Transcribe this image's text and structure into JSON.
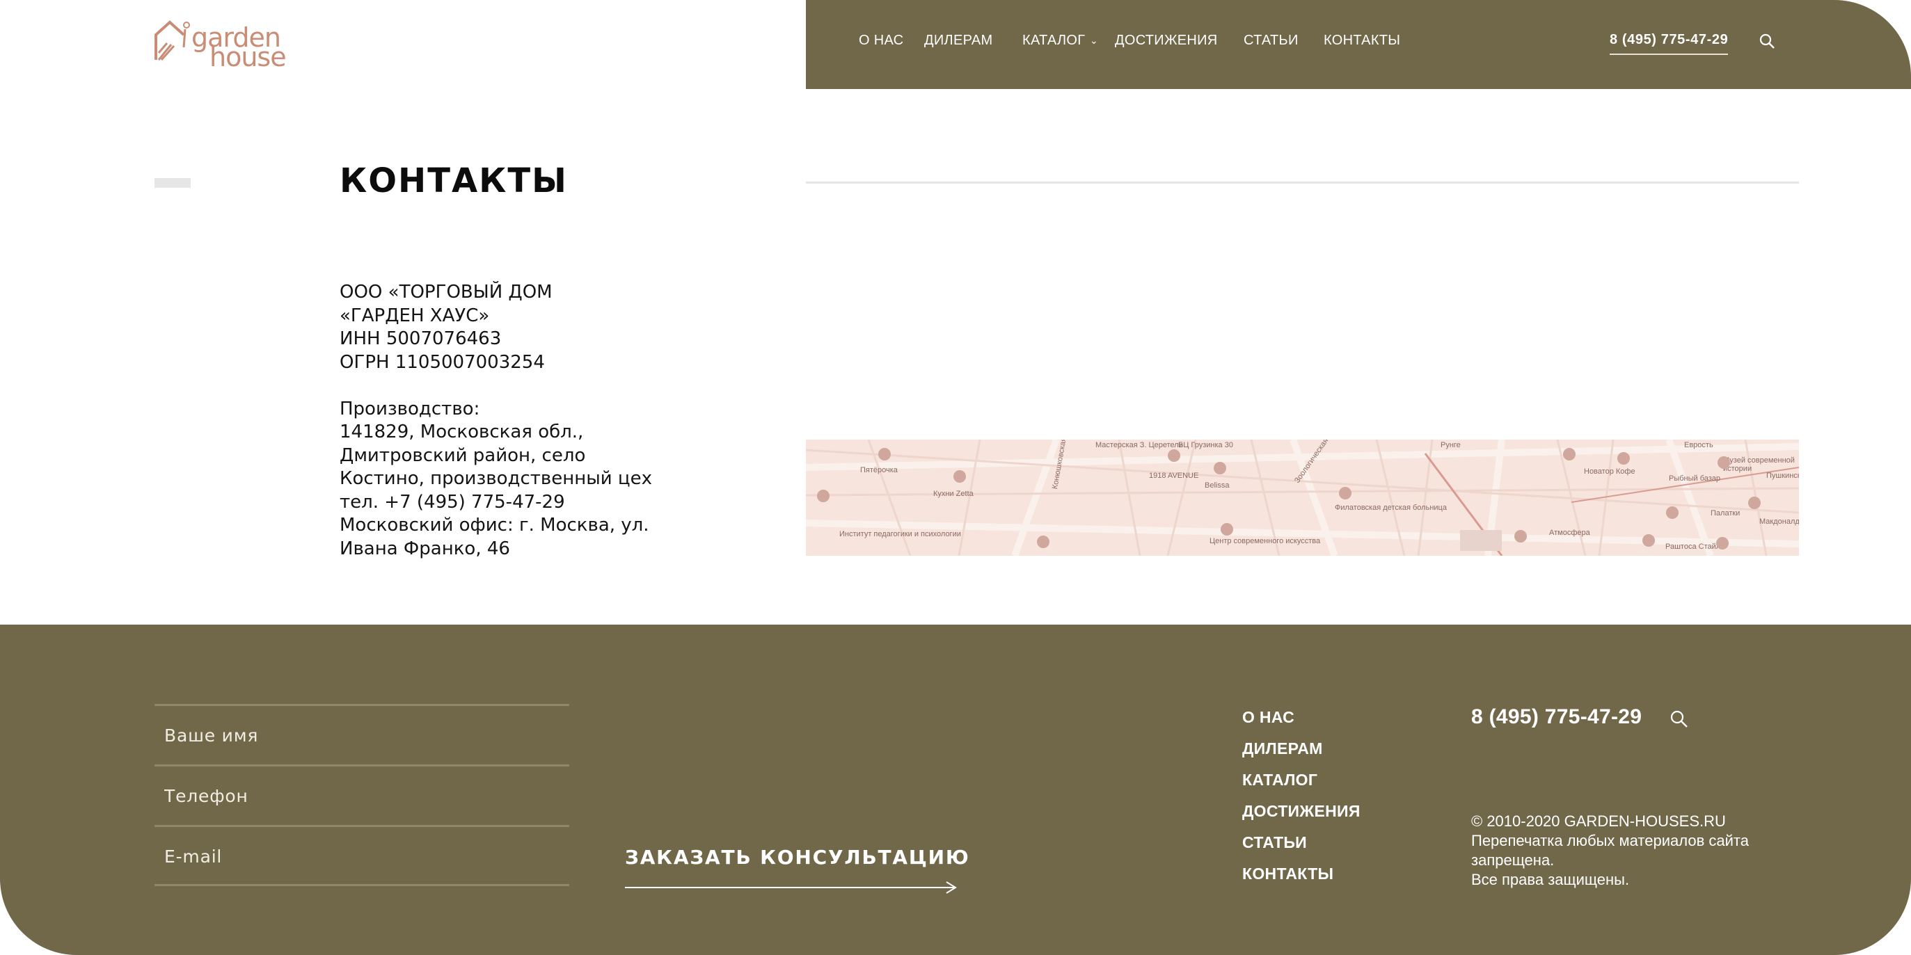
{
  "logo": {
    "line1": "garden",
    "line2": "house"
  },
  "nav": {
    "items": [
      {
        "label": "О НАС"
      },
      {
        "label": "ДИЛЕРАМ"
      },
      {
        "label": "КАТАЛОГ"
      },
      {
        "label": "ДОСТИЖЕНИЯ"
      },
      {
        "label": "СТАТЬИ"
      },
      {
        "label": "КОНТАКТЫ"
      }
    ],
    "chevron": "⌄",
    "phone": "8 (495) 775-47-29",
    "search_icon": "search-icon"
  },
  "page": {
    "title": "КОНТАКТЫ"
  },
  "company": {
    "lines": [
      "ООО «ТОРГОВЫЙ ДОМ",
      "«ГАРДЕН ХАУС»",
      "ИНН 5007076463",
      "ОГРН 1105007003254"
    ],
    "production": [
      "Производство:",
      "141829, Московская обл.,",
      "Дмитровский район, село",
      "Костино, производственный цех",
      "тел. +7 (495) 775-47-29",
      "Московский офис: г. Москва, ул.",
      "Ивана Франко, 46"
    ]
  },
  "map": {
    "labels": [
      "Пятёрочка",
      "Мастерская З. Церетели",
      "БЦ Грузинка 30",
      "1918 AVENUE",
      "Кухни Zetta",
      "Институт педагогики и психологии",
      "Belissa",
      "Филатовская детская больница",
      "Центр современного искусства",
      "Новатор Кофе",
      "Рыбный базар",
      "Музей современной истории",
      "Пушкинская",
      "Палатки",
      "Макдоналдс",
      "Атмосфера",
      "Раштоса Стайл",
      "Зоологическая ул.",
      "Конюшковская ул.",
      "Рунге",
      "Еврость"
    ]
  },
  "footer": {
    "form": {
      "name_placeholder": "Ваше имя",
      "phone_placeholder": "Телефон",
      "email_placeholder": "E-mail",
      "submit_label": "ЗАКАЗАТЬ КОНСУЛЬТАЦИЮ"
    },
    "nav": [
      {
        "label": "О НАС"
      },
      {
        "label": "ДИЛЕРАМ"
      },
      {
        "label": "КАТАЛОГ"
      },
      {
        "label": "ДОСТИЖЕНИЯ"
      },
      {
        "label": "СТАТЬИ"
      },
      {
        "label": "КОНТАКТЫ"
      }
    ],
    "phone": "8 (495) 775-47-29",
    "copyright": [
      "© 2010-2020 GARDEN-HOUSES.RU",
      "Перепечатка любых материалов сайта",
      "запрещена.",
      "Все права защищены."
    ]
  },
  "colors": {
    "olive": "#716749",
    "logo": "#c98c74",
    "map": "#f6e4dd"
  }
}
